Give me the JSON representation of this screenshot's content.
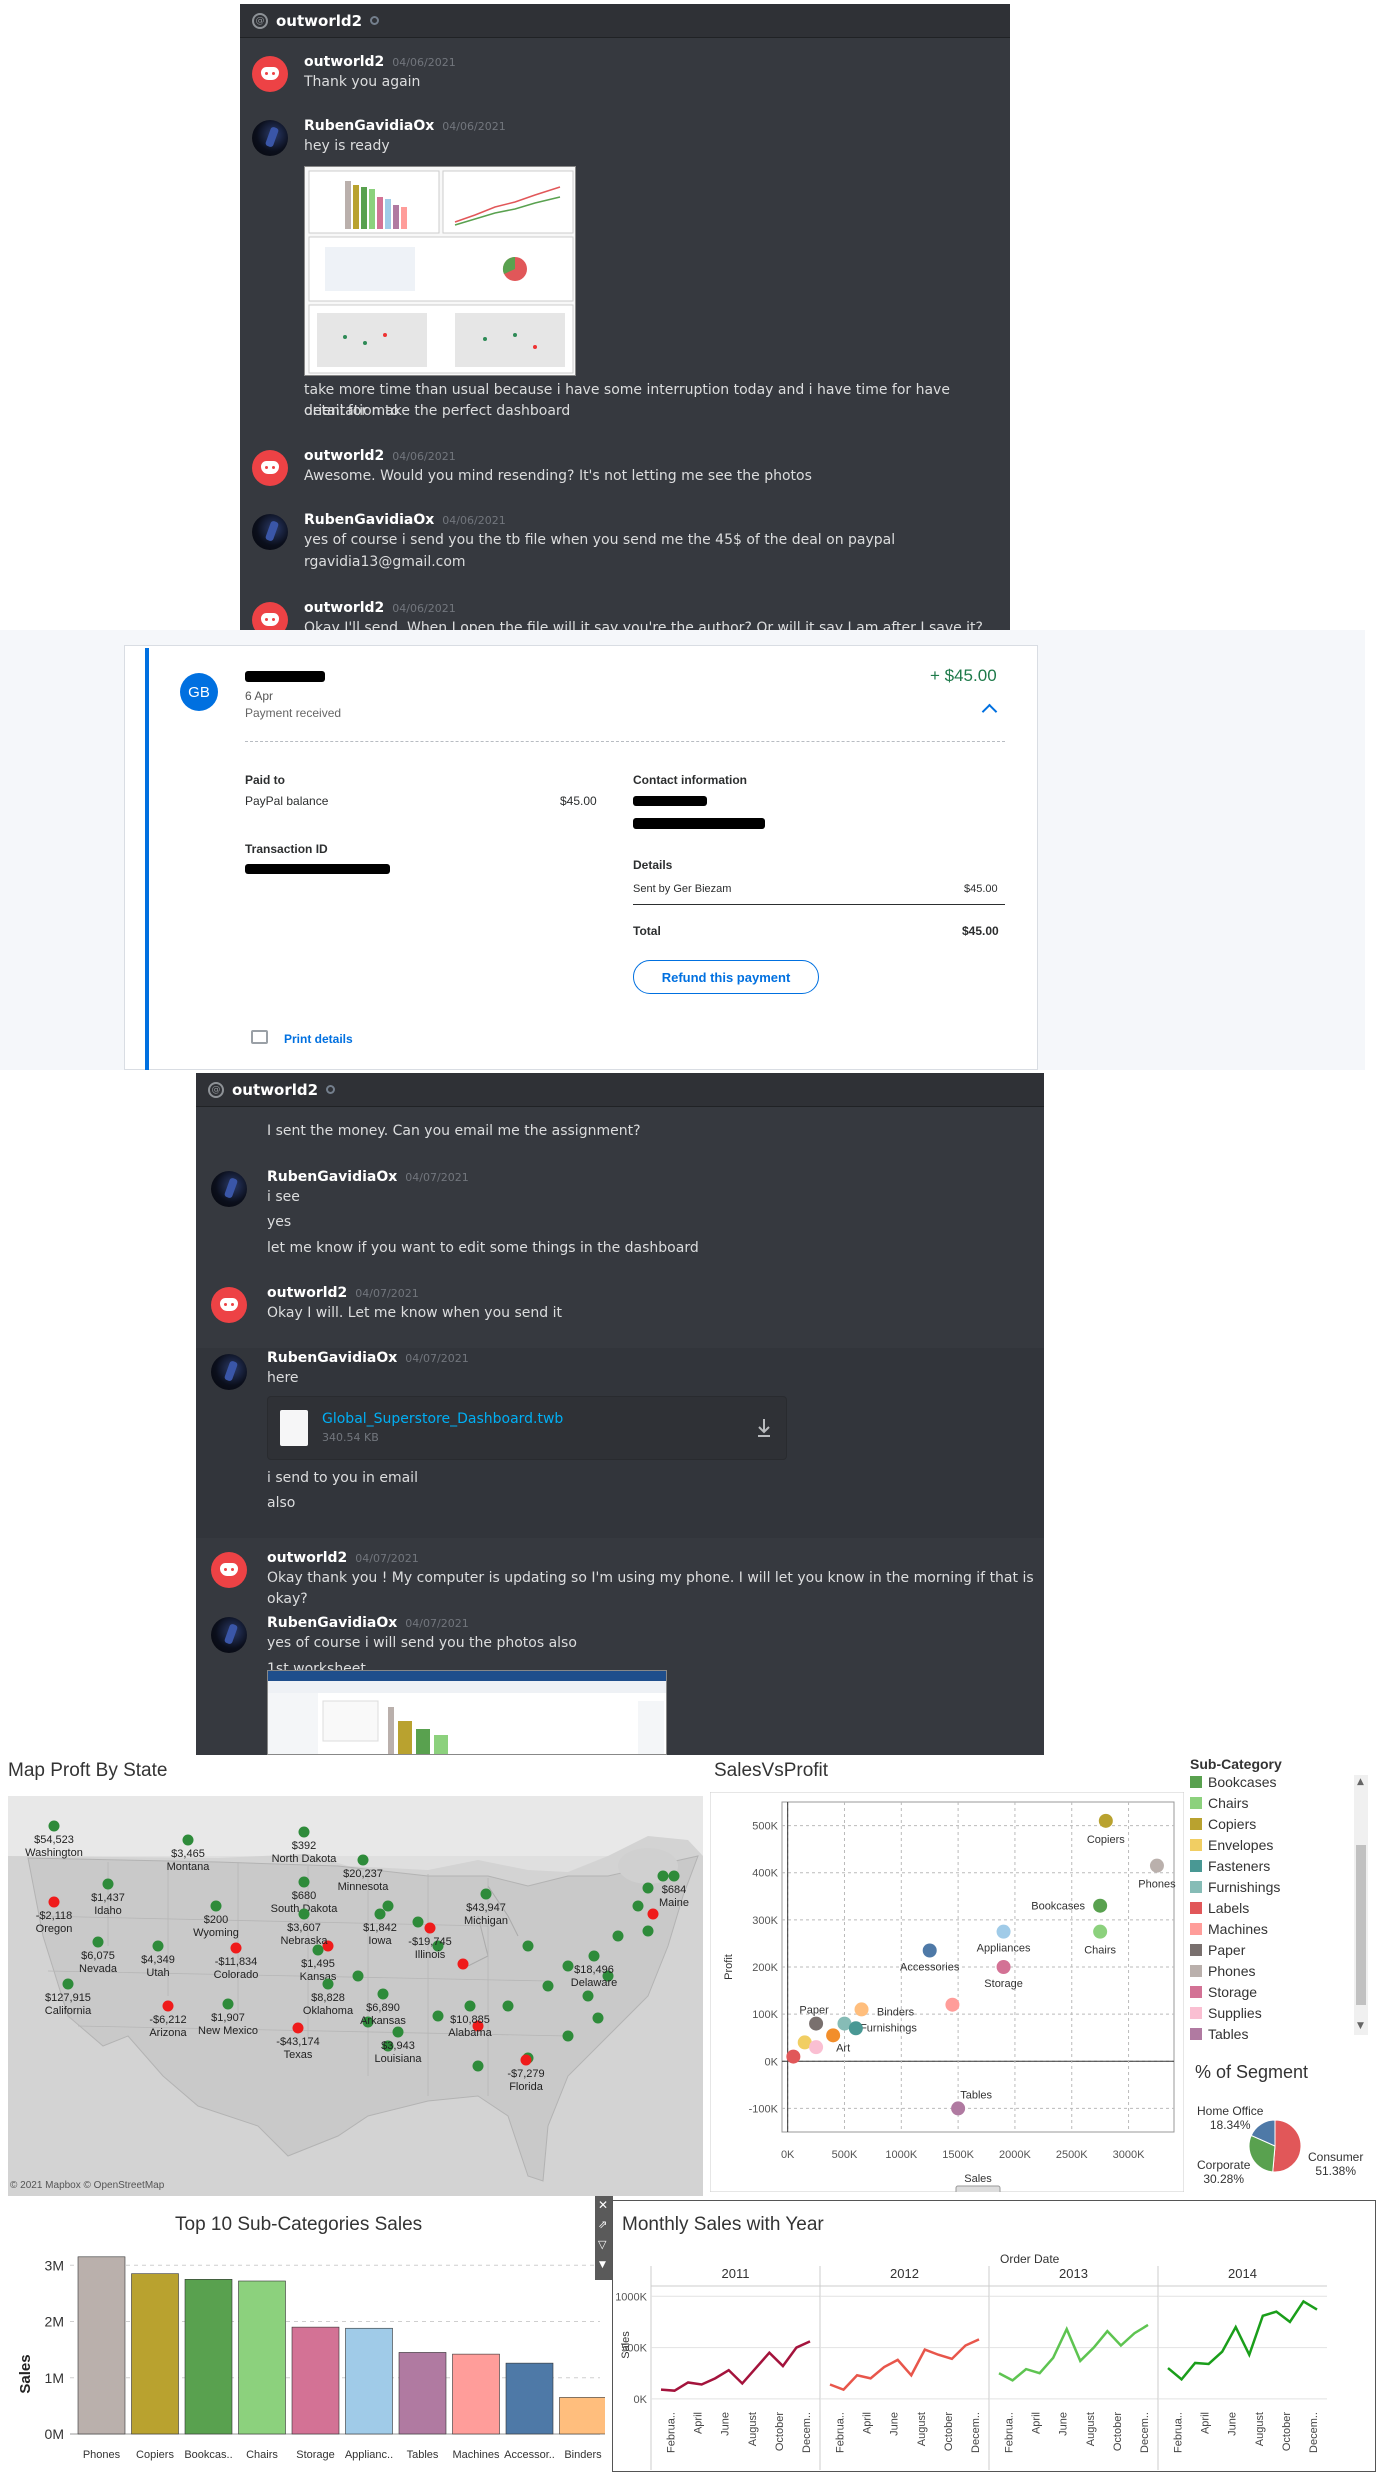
{
  "discord1": {
    "channel": "outworld2",
    "messages": [
      {
        "author": "outworld2",
        "date": "04/06/2021",
        "lines": [
          "Thank you again"
        ]
      },
      {
        "author": "RubenGavidiaOx",
        "date": "04/06/2021",
        "lines": [
          "hey is ready"
        ]
      },
      {
        "lines": [
          "take more time than usual because i have some interruption today and i have time for have orientation to",
          "detail for make the perfect dashboard"
        ]
      },
      {
        "author": "outworld2",
        "date": "04/06/2021",
        "lines": [
          "Awesome. Would you mind resending? It's not letting me see the photos"
        ]
      },
      {
        "author": "RubenGavidiaOx",
        "date": "04/06/2021",
        "lines": [
          "yes of course i send you the tb file when you send me the 45$ of the deal on paypal",
          "rgavidia13@gmail.com"
        ]
      },
      {
        "author": "outworld2",
        "date": "04/06/2021",
        "lines": [
          "Okay I'll send. When I open the file will it say you're the author? Or will it say I am after I save it?"
        ]
      }
    ]
  },
  "paypal": {
    "avatar_initials": "GB",
    "date": "6 Apr",
    "status": "Payment received",
    "amount": "+ $45.00",
    "paid_to_label": "Paid to",
    "balance_label": "PayPal balance",
    "balance_amount": "$45.00",
    "transaction_label": "Transaction ID",
    "contact_label": "Contact information",
    "details_label": "Details",
    "sent_by": "Sent by Ger Biezam",
    "sent_amount": "$45.00",
    "total_label": "Total",
    "total_amount": "$45.00",
    "refund_button": "Refund this payment",
    "print_link": "Print details"
  },
  "discord2": {
    "channel": "outworld2",
    "messages": [
      {
        "lines": [
          "I sent the money. Can you email me the assignment?"
        ]
      },
      {
        "author": "RubenGavidiaOx",
        "date": "04/07/2021",
        "lines": [
          "i see",
          "yes",
          "let me know if you want to edit some things in the dashboard"
        ]
      },
      {
        "author": "outworld2",
        "date": "04/07/2021",
        "lines": [
          "Okay I will. Let me know when you send it"
        ]
      },
      {
        "author": "RubenGavidiaOx",
        "date": "04/07/2021",
        "lines": [
          "here"
        ]
      },
      {
        "lines": [
          "i send to you in email",
          "also"
        ]
      },
      {
        "author": "outworld2",
        "date": "04/07/2021",
        "lines": [
          "Okay thank you ! My computer is updating so I'm using my phone. I will let you know in the morning if that is okay?"
        ]
      },
      {
        "author": "RubenGavidiaOx",
        "date": "04/07/2021",
        "lines": [
          "yes of course i will send you the photos also",
          "1st worksheet"
        ]
      }
    ],
    "attachment": {
      "filename": "Global_Superstore_Dashboard.twb",
      "size": "340.54 KB"
    }
  },
  "map": {
    "title": "Map Proft By State",
    "attribution": "© 2021 Mapbox © OpenStreetMap",
    "labels": [
      {
        "name": "Washington",
        "value": "$54,523"
      },
      {
        "name": "Oregon",
        "value": "-$2,118"
      },
      {
        "name": "California",
        "value": "$127,915"
      },
      {
        "name": "Idaho",
        "value": "$1,437"
      },
      {
        "name": "Nevada",
        "value": "$6,075"
      },
      {
        "name": "Arizona",
        "value": "-$6,212"
      },
      {
        "name": "Montana",
        "value": "$3,465"
      },
      {
        "name": "Wyoming",
        "value": "$200"
      },
      {
        "name": "Utah",
        "value": "$4,349"
      },
      {
        "name": "Colorado",
        "value": "-$11,834"
      },
      {
        "name": "New Mexico",
        "value": "$1,907"
      },
      {
        "name": "North Dakota",
        "value": "$392"
      },
      {
        "name": "South Dakota",
        "value": "$680"
      },
      {
        "name": "Nebraska",
        "value": "$3,607"
      },
      {
        "name": "Kansas",
        "value": "$1,495"
      },
      {
        "name": "Oklahoma",
        "value": "$8,828"
      },
      {
        "name": "Texas",
        "value": "-$43,174"
      },
      {
        "name": "Minnesota",
        "value": "$20,237"
      },
      {
        "name": "Iowa",
        "value": "$1,842"
      },
      {
        "name": "Arkansas",
        "value": "$6,890"
      },
      {
        "name": "Louisiana",
        "value": "$3,943"
      },
      {
        "name": "Illinois",
        "value": "-$19,745"
      },
      {
        "name": "Michigan",
        "value": "$43,947"
      },
      {
        "name": "Alabama",
        "value": "$10,885"
      },
      {
        "name": "Florida",
        "value": "-$7,279"
      },
      {
        "name": "Delaware",
        "value": "$18,496"
      },
      {
        "name": "Maine",
        "value": "$684"
      }
    ]
  },
  "chart_data": [
    {
      "type": "scatter",
      "title": "SalesVsProfit",
      "xlabel": "Sales",
      "ylabel": "Profit",
      "xlim": [
        -50000,
        3400000
      ],
      "ylim": [
        -150000,
        550000
      ],
      "xticks": [
        "0K",
        "500K",
        "1000K",
        "1500K",
        "2000K",
        "2500K",
        "3000K"
      ],
      "yticks": [
        "-100K",
        "0K",
        "100K",
        "200K",
        "300K",
        "400K",
        "500K"
      ],
      "points": [
        {
          "name": "Copiers",
          "x": 2800000,
          "y": 510000,
          "color": "#b9a22f"
        },
        {
          "name": "Phones",
          "x": 3250000,
          "y": 415000,
          "color": "#bab0ac"
        },
        {
          "name": "Bookcases",
          "x": 2750000,
          "y": 330000,
          "color": "#59a14f"
        },
        {
          "name": "Chairs",
          "x": 2750000,
          "y": 275000,
          "color": "#8cd17d"
        },
        {
          "name": "Appliances",
          "x": 1900000,
          "y": 275000,
          "color": "#a0cbe8"
        },
        {
          "name": "Accessories",
          "x": 1250000,
          "y": 235000,
          "color": "#4e79a7"
        },
        {
          "name": "Storage",
          "x": 1900000,
          "y": 200000,
          "color": "#d37295"
        },
        {
          "name": "Machines",
          "x": 1450000,
          "y": 120000,
          "color": "#ff9d9a"
        },
        {
          "name": "Binders",
          "x": 650000,
          "y": 110000,
          "color": "#ffbe7d"
        },
        {
          "name": "Paper",
          "x": 250000,
          "y": 80000,
          "color": "#79706e"
        },
        {
          "name": "Furnishings",
          "x": 500000,
          "y": 80000,
          "color": "#86bcb6"
        },
        {
          "name": "Fasteners",
          "x": 600000,
          "y": 70000,
          "color": "#499894"
        },
        {
          "name": "Art",
          "x": 400000,
          "y": 55000,
          "color": "#f28e2b"
        },
        {
          "name": "Envelopes",
          "x": 150000,
          "y": 40000,
          "color": "#f1ce63"
        },
        {
          "name": "Supplies",
          "x": 250000,
          "y": 30000,
          "color": "#fabfd2"
        },
        {
          "name": "Labels",
          "x": 50000,
          "y": 10000,
          "color": "#e15759"
        },
        {
          "name": "Tables",
          "x": 1500000,
          "y": -100000,
          "color": "#b07aa1"
        }
      ]
    },
    {
      "type": "pie",
      "title": "% of Segment",
      "slices": [
        {
          "name": "Consumer",
          "value": 51.38,
          "color": "#e15759"
        },
        {
          "name": "Corporate",
          "value": 30.28,
          "color": "#59a14f"
        },
        {
          "name": "Home Office",
          "value": 18.34,
          "color": "#4e79a7"
        }
      ]
    },
    {
      "type": "bar",
      "title": "Top 10 Sub-Categories Sales",
      "ylabel": "Sales",
      "ylim": [
        0,
        3200000
      ],
      "yticks": [
        "0M",
        "1M",
        "2M",
        "3M"
      ],
      "categories": [
        "Phones",
        "Copiers",
        "Bookcas..",
        "Chairs",
        "Storage",
        "Applianc..",
        "Tables",
        "Machines",
        "Accessor..",
        "Binders"
      ],
      "values": [
        3150000,
        2850000,
        2750000,
        2720000,
        1900000,
        1880000,
        1450000,
        1420000,
        1260000,
        650000
      ],
      "colors": [
        "#bab0ac",
        "#b9a22f",
        "#59a14f",
        "#8cd17d",
        "#d37295",
        "#a0cbe8",
        "#b07aa1",
        "#ff9d9a",
        "#4e79a7",
        "#ffbe7d"
      ]
    },
    {
      "type": "line",
      "title": "Monthly Sales with Year",
      "header": "Order Date",
      "ylabel": "Sales",
      "ylim": [
        -50000,
        1100000
      ],
      "yticks": [
        "0K",
        "500K",
        "1000K"
      ],
      "month_ticks": [
        "Februa..",
        "April",
        "June",
        "August",
        "October",
        "Decem.."
      ],
      "series": [
        {
          "name": "2011",
          "color": "#a4133c",
          "values": [
            90000,
            80000,
            160000,
            140000,
            200000,
            280000,
            150000,
            300000,
            450000,
            320000,
            500000,
            560000
          ]
        },
        {
          "name": "2012",
          "color": "#e8564b",
          "values": [
            140000,
            90000,
            230000,
            200000,
            310000,
            380000,
            230000,
            480000,
            430000,
            390000,
            520000,
            580000
          ]
        },
        {
          "name": "2013",
          "color": "#5ec451",
          "values": [
            250000,
            180000,
            290000,
            250000,
            400000,
            680000,
            370000,
            500000,
            660000,
            520000,
            640000,
            720000
          ]
        },
        {
          "name": "2014",
          "color": "#1a9e1a",
          "values": [
            300000,
            190000,
            350000,
            340000,
            460000,
            700000,
            430000,
            810000,
            850000,
            750000,
            950000,
            870000
          ]
        }
      ]
    }
  ],
  "legend": {
    "title": "Sub-Category",
    "items": [
      {
        "name": "Bookcases",
        "color": "#59a14f"
      },
      {
        "name": "Chairs",
        "color": "#8cd17d"
      },
      {
        "name": "Copiers",
        "color": "#b9a22f"
      },
      {
        "name": "Envelopes",
        "color": "#f1ce63"
      },
      {
        "name": "Fasteners",
        "color": "#499894"
      },
      {
        "name": "Furnishings",
        "color": "#86bcb6"
      },
      {
        "name": "Labels",
        "color": "#e15759"
      },
      {
        "name": "Machines",
        "color": "#ff9d9a"
      },
      {
        "name": "Paper",
        "color": "#79706e"
      },
      {
        "name": "Phones",
        "color": "#bab0ac"
      },
      {
        "name": "Storage",
        "color": "#d37295"
      },
      {
        "name": "Supplies",
        "color": "#fabfd2"
      },
      {
        "name": "Tables",
        "color": "#b07aa1"
      }
    ]
  },
  "segment_labels": {
    "home_office": "Home Office",
    "home_office_pct": "18.34%",
    "corporate": "Corporate",
    "corporate_pct": "30.28%",
    "consumer": "Consumer",
    "consumer_pct": "51.38%"
  }
}
